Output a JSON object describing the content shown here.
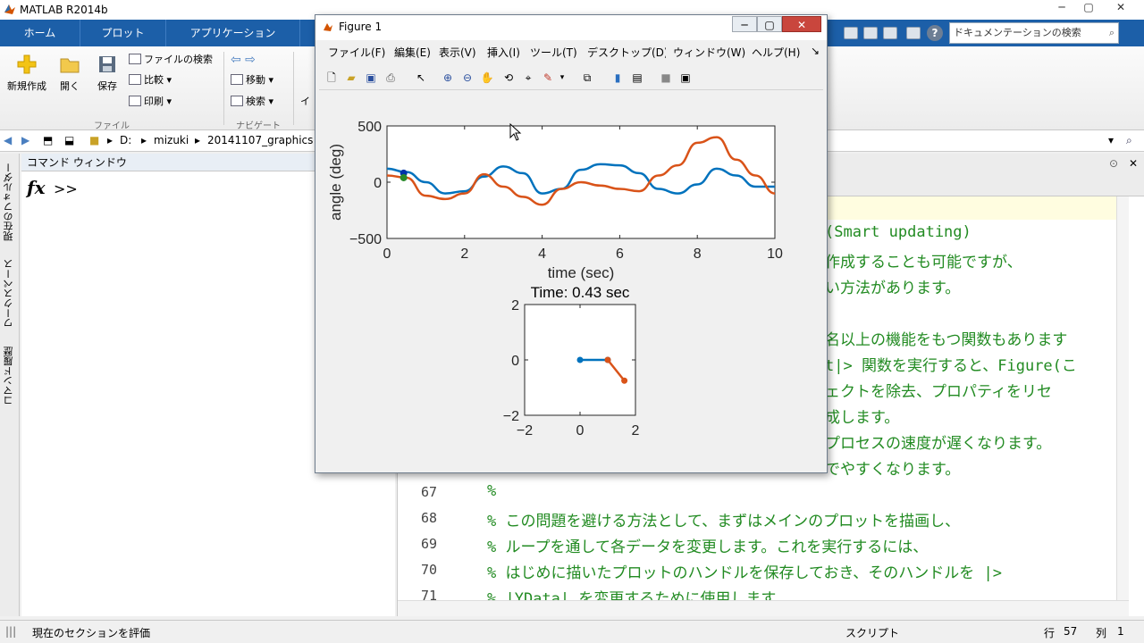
{
  "app": {
    "title": "MATLAB R2014b",
    "window_controls": [
      "─",
      "▢",
      "✕"
    ]
  },
  "ribbon_tabs": {
    "home": "ホーム",
    "plot": "プロット",
    "apps": "アプリケーション"
  },
  "search": {
    "placeholder": "ドキュメンテーションの検索"
  },
  "ribbon": {
    "new_label": "新規作成",
    "open_label": "開く",
    "save_label": "保存",
    "find_files_label": "ファイルの検索",
    "compare_label": "比較",
    "print_label": "印刷",
    "goto_label": "移動",
    "find_label": "検索",
    "group_file": "ファイル",
    "group_navigate": "ナビゲート",
    "truncated_label": "イ"
  },
  "address": {
    "drive": "D:",
    "folder1": "mizuki",
    "folder2": "20141107_graphics"
  },
  "left_rail": {
    "current_folder": "現在のフォルダー",
    "workspace": "ワークスペース",
    "command_history": "コマンド履歴"
  },
  "command_window": {
    "title": "コマンド ウィンドウ",
    "fx": "fx",
    "prompt": ">>"
  },
  "editor": {
    "lines": [
      {
        "no": "",
        "text": "(Smart updating)"
      },
      {
        "no": "",
        "text": "作成することも可能ですが、"
      },
      {
        "no": "",
        "text": "い方法があります。"
      },
      {
        "no": "",
        "text": ""
      },
      {
        "no": "",
        "text": "名以上の機能をもつ関数もあります"
      },
      {
        "no": "",
        "text": "t|> 関数を実行すると、Figure(こ"
      },
      {
        "no": "",
        "text": "ェクトを除去、プロパティをリセ"
      },
      {
        "no": "",
        "text": "成します。"
      },
      {
        "no": "",
        "text": "プロセスの速度が遅くなります。"
      },
      {
        "no": "",
        "text": "でやすくなります。"
      },
      {
        "no": "67",
        "text": "%"
      },
      {
        "no": "68",
        "text": "% この問題を避ける方法として、まずはメインのプロットを描画し、"
      },
      {
        "no": "69",
        "text": "% ループを通して各データを変更します。これを実行するには、"
      },
      {
        "no": "70",
        "text": "% はじめに描いたプロットのハンドルを保存しておき、そのハンドルを |>"
      },
      {
        "no": "71",
        "text": "% |YData| を変更するために使用します。"
      }
    ]
  },
  "status": {
    "left": "現在のセクションを評価",
    "mode": "スクリプト",
    "row_label": "行",
    "row": "57",
    "col_label": "列",
    "col": "1"
  },
  "figure": {
    "title": "Figure 1",
    "menu": [
      "ファイル(F)",
      "編集(E)",
      "表示(V)",
      "挿入(I)",
      "ツール(T)",
      "デスクトップ(D)",
      "ウィンドウ(W)",
      "ヘルプ(H)"
    ],
    "menu_more": "↘",
    "controls": [
      "─",
      "▢",
      "✕"
    ]
  },
  "chart_data": [
    {
      "type": "line",
      "title": "",
      "xlabel": "time (sec)",
      "ylabel": "angle (deg)",
      "xlim": [
        0,
        10
      ],
      "ylim": [
        -500,
        500
      ],
      "xticks": [
        "0",
        "2",
        "4",
        "6",
        "8",
        "10"
      ],
      "yticks": [
        "500",
        "0",
        "−500"
      ],
      "series": [
        {
          "color": "#0072bd",
          "x": [
            0,
            0.5,
            1,
            1.5,
            2,
            2.5,
            3,
            3.5,
            4,
            4.5,
            5,
            5.5,
            6,
            6.5,
            7,
            7.5,
            8,
            8.5,
            9,
            9.5,
            10
          ],
          "y": [
            120,
            90,
            0,
            -100,
            -80,
            50,
            140,
            80,
            -100,
            -60,
            110,
            160,
            150,
            80,
            -60,
            -100,
            -20,
            120,
            60,
            -40,
            -40
          ]
        },
        {
          "color": "#d95319",
          "x": [
            0,
            0.5,
            1,
            1.5,
            2,
            2.5,
            3,
            3.5,
            4,
            4.5,
            5,
            5.5,
            6,
            6.5,
            7,
            7.5,
            8,
            8.5,
            9,
            9.5,
            10
          ],
          "y": [
            60,
            40,
            -120,
            -150,
            -100,
            70,
            -40,
            -130,
            -200,
            -60,
            0,
            -30,
            -60,
            -80,
            60,
            150,
            350,
            400,
            200,
            60,
            -100
          ]
        }
      ],
      "markers": [
        {
          "x": 0.43,
          "y": 80,
          "color": "#0033aa"
        },
        {
          "x": 0.43,
          "y": 40,
          "color": "#2a8a2a"
        }
      ]
    },
    {
      "type": "line",
      "title": "Time: 0.43 sec",
      "xlim": [
        -2,
        2
      ],
      "ylim": [
        -2,
        2
      ],
      "xticks": [
        "−2",
        "0",
        "2"
      ],
      "yticks": [
        "2",
        "0",
        "−2"
      ],
      "series": [
        {
          "color": "#0072bd",
          "x": [
            0,
            1
          ],
          "y": [
            0,
            0
          ]
        },
        {
          "color": "#d95319",
          "x": [
            1,
            1.6
          ],
          "y": [
            0,
            -0.75
          ]
        }
      ]
    }
  ]
}
